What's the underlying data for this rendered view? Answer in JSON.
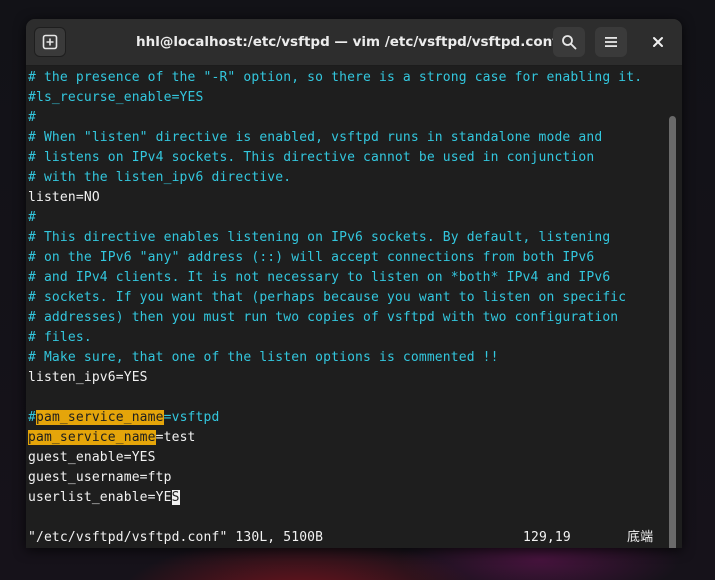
{
  "window": {
    "title": "hhl@localhost:/etc/vsftpd — vim /etc/vsftpd/vsftpd.conf"
  },
  "header": {
    "new_tab_icon": "new-tab-icon",
    "search_icon": "search-icon",
    "menu_icon": "hamburger-menu-icon",
    "close_icon": "close-icon"
  },
  "colors": {
    "comment": "#33c7de",
    "search_highlight": "#e5a50a",
    "text": "#f2f2f2",
    "background": "#1e1e1e"
  },
  "editor": {
    "lines": [
      "# the presence of the \"-R\" option, so there is a strong case for enabling it.",
      "#ls_recurse_enable=YES",
      "#",
      "# When \"listen\" directive is enabled, vsftpd runs in standalone mode and",
      "# listens on IPv4 sockets. This directive cannot be used in conjunction",
      "# with the listen_ipv6 directive.",
      "listen=NO",
      "#",
      "# This directive enables listening on IPv6 sockets. By default, listening",
      "# on the IPv6 \"any\" address (::) will accept connections from both IPv6",
      "# and IPv4 clients. It is not necessary to listen on *both* IPv4 and IPv6",
      "# sockets. If you want that (perhaps because you want to listen on specific",
      "# addresses) then you must run two copies of vsftpd with two configuration",
      "# files.",
      "# Make sure, that one of the listen options is commented !!",
      "listen_ipv6=YES",
      "",
      "#pam_service_name=vsftpd",
      "pam_service_name=test",
      "guest_enable=YES",
      "guest_username=ftp",
      "userlist_enable=YES"
    ],
    "search_match": "pam_service_name",
    "line17": {
      "hash": "#",
      "match": "pam_service_name",
      "rest": "=vsftpd"
    },
    "line18": {
      "match": "pam_service_name",
      "rest": "=test"
    },
    "line21": {
      "before": "userlist_enable=YE",
      "cursor_char": "S"
    }
  },
  "statusline": {
    "file_info": "\"/etc/vsftpd/vsftpd.conf\" 130L, 5100B",
    "position": "129,19",
    "scroll": "底端"
  }
}
